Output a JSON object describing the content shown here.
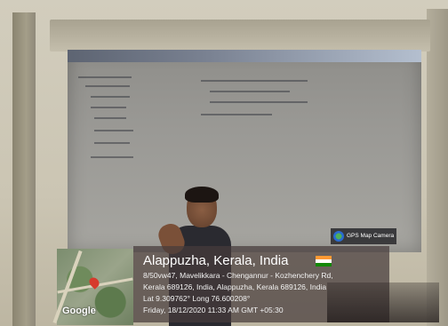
{
  "badge": {
    "text": "GPS Map Camera",
    "icon": "gps-map-camera-icon"
  },
  "map": {
    "attribution": "Google",
    "pin_color": "#d63a2c"
  },
  "location": {
    "title": "Alappuzha, Kerala, India",
    "flag": "india-flag",
    "address_line1": "8/50vw47, Mavelikkara - Chengannur - Kozhenchery Rd,",
    "address_line2": "Kerala 689126, India, Alappuzha, Kerala 689126, India",
    "coords": "Lat 9.309762° Long 76.600208°",
    "datetime": "Friday, 18/12/2020 11:33 AM GMT +05:30"
  }
}
